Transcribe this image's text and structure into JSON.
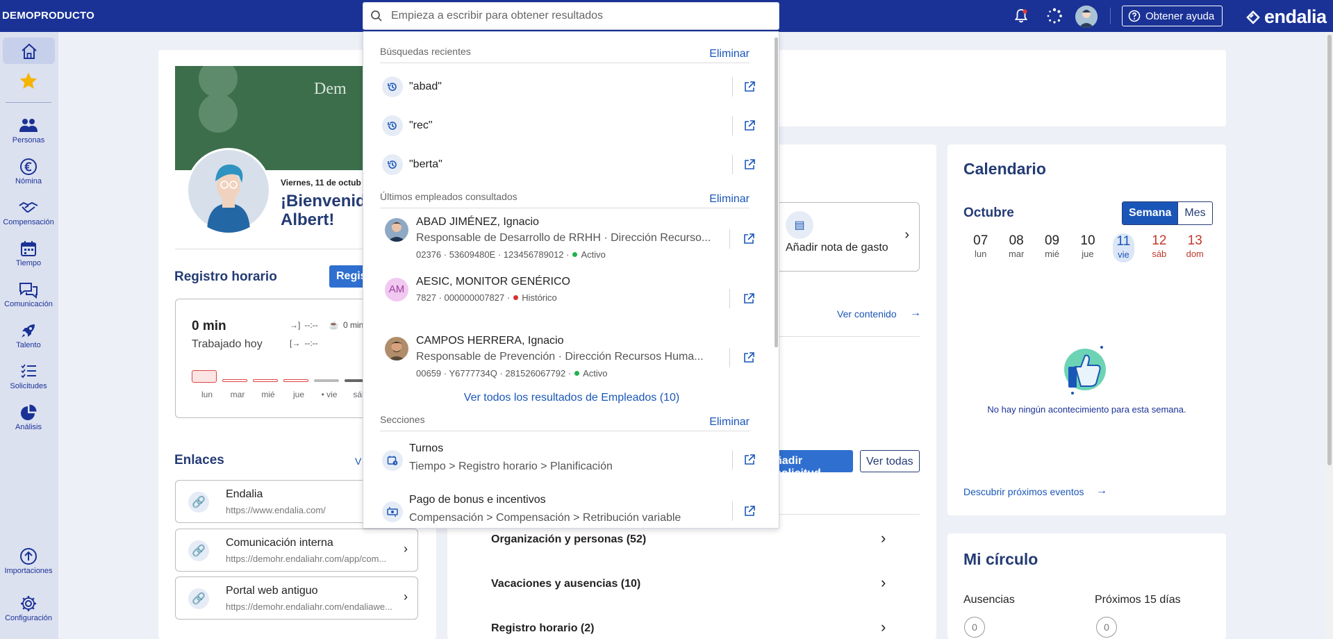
{
  "header": {
    "company": "DEMOPRODUCTO",
    "help_label": "Obtener ayuda",
    "brand": "endalia"
  },
  "search": {
    "placeholder": "Empieza a escribir para obtener resultados",
    "recent": {
      "title": "Búsquedas recientes",
      "delete_label": "Eliminar",
      "items": [
        "\"abad\"",
        "\"rec\"",
        "\"berta\""
      ]
    },
    "employees": {
      "title": "Últimos empleados consultados",
      "delete_label": "Eliminar",
      "items": [
        {
          "name": "ABAD JIMÉNEZ, Ignacio",
          "role": "Responsable de Desarrollo de RRHH · Dirección Recurso...",
          "meta": "02376 · 53609480E · 123456789012 ·",
          "status": "Activo",
          "status_color": "#22b14c"
        },
        {
          "name": "AESIC, MONITOR GENÉRICO",
          "initials": "AM",
          "meta": "7827 · 000000007827 ·",
          "status": "Histórico",
          "status_color": "#d63333"
        },
        {
          "name": "CAMPOS HERRERA, Ignacio",
          "role": "Responsable de Prevención · Dirección Recursos Huma...",
          "meta": "00659 · Y6777734Q · 281526067792 ·",
          "status": "Activo",
          "status_color": "#22b14c"
        }
      ],
      "see_all": "Ver todos los resultados de Empleados (10)"
    },
    "sections": {
      "title": "Secciones",
      "delete_label": "Eliminar",
      "items": [
        {
          "title": "Turnos",
          "path": "Tiempo > Registro horario > Planificación"
        },
        {
          "title": "Pago de bonus e incentivos",
          "path": "Compensación > Compensación > Retribución variable"
        }
      ]
    }
  },
  "sidebar": {
    "items": [
      {
        "label": "Personas"
      },
      {
        "label": "Nómina"
      },
      {
        "label": "Compensación"
      },
      {
        "label": "Tiempo"
      },
      {
        "label": "Comunicación"
      },
      {
        "label": "Talento"
      },
      {
        "label": "Solicitudes"
      },
      {
        "label": "Análisis"
      },
      {
        "label": "Importaciones"
      },
      {
        "label": "Configuración"
      }
    ]
  },
  "profile": {
    "banner_text": "Dem",
    "date": "Viernes, 11 de octub",
    "greeting_line1": "¡Bienvenido",
    "greeting_line2": "Albert!"
  },
  "timesheet": {
    "title": "Registro horario",
    "button": "Regis",
    "worked": "0 min",
    "worked_label": "Trabajado hoy",
    "in_time": "--:--",
    "out_time": "--:--",
    "break_label": "0 min",
    "days": [
      "lun",
      "mar",
      "mié",
      "jue",
      "• vie",
      "sáb"
    ]
  },
  "links": {
    "title": "Enlaces",
    "more": "V",
    "items": [
      {
        "title": "Endalia",
        "url": "https://www.endalia.com/"
      },
      {
        "title": "Comunicación interna",
        "url": "https://demohr.endaliahr.com/app/com..."
      },
      {
        "title": "Portal web antiguo",
        "url": "https://demohr.endaliahr.com/endaliawe..."
      }
    ]
  },
  "middle": {
    "expense_label": "Añadir nota de gasto",
    "see_content": "Ver contenido",
    "add_request": "ñadir solicitud",
    "see_all": "Ver todas",
    "request_rows": [
      {
        "label": "Organización y personas (52)"
      },
      {
        "label": "Vacaciones y ausencias (10)"
      },
      {
        "label": "Registro horario (2)"
      }
    ]
  },
  "calendar": {
    "title": "Calendario",
    "month": "Octubre",
    "view_week": "Semana",
    "view_month": "Mes",
    "days": [
      {
        "num": "07",
        "name": "lun"
      },
      {
        "num": "08",
        "name": "mar"
      },
      {
        "num": "09",
        "name": "mié"
      },
      {
        "num": "10",
        "name": "jue"
      },
      {
        "num": "11",
        "name": "vie"
      },
      {
        "num": "12",
        "name": "sáb"
      },
      {
        "num": "13",
        "name": "dom"
      }
    ],
    "empty_text": "No hay ningún acontecimiento para esta semana.",
    "discover": "Descubrir próximos eventos"
  },
  "circle": {
    "title": "Mi círculo",
    "absences": "Ausencias",
    "next15": "Próximos 15 días",
    "absences_count": "0",
    "next15_count": "0"
  },
  "colors": {
    "topbar": "#1a3296",
    "accent": "#1a56b8",
    "weekend": "#c0392b"
  }
}
